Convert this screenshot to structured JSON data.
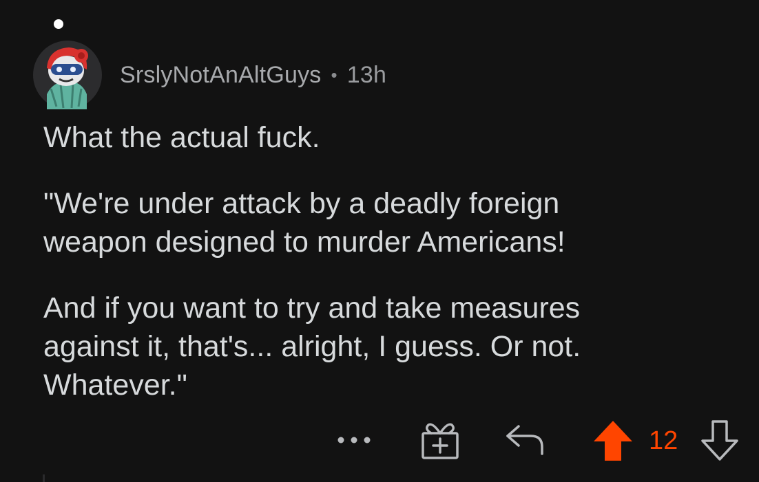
{
  "comment": {
    "username": "SrslyNotAnAltGuys",
    "separator": "•",
    "age": "13h",
    "paragraphs": [
      "What the actual fuck.",
      "\"We're under attack by a deadly foreign weapon designed to murder Americans!",
      "And if you want to try and take measures against it, that's... alright, I guess. Or not. Whatever.\""
    ]
  },
  "actions": {
    "more": "more-icon",
    "award": "gift-award-icon",
    "reply": "reply-arrow-icon",
    "upvote": "upvote-arrow-icon",
    "score": "12",
    "downvote": "downvote-arrow-icon"
  },
  "colors": {
    "background": "#121212",
    "text": "#d7dadc",
    "meta": "#9a9c9f",
    "upvote_active": "#ff4500",
    "icon": "#b8babd"
  }
}
